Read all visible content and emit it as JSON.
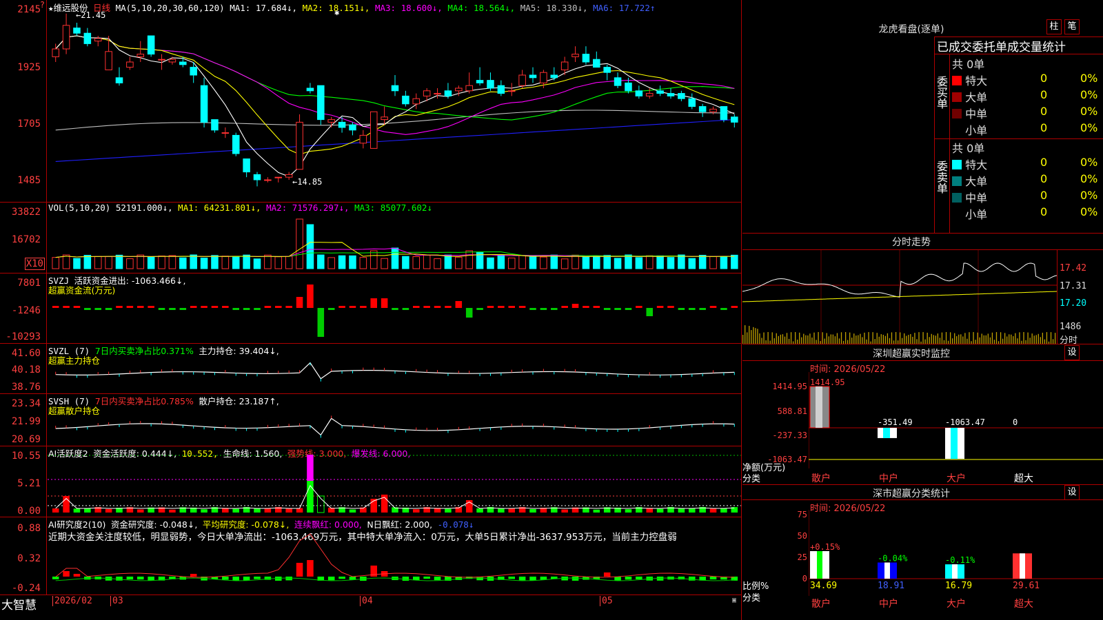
{
  "stock": {
    "name": "维远股份",
    "period": "日线",
    "star": "★"
  },
  "ma_line": {
    "prefix": "MA(5,10,20,30,60,120)",
    "ma1": "MA1: 17.684↓,",
    "ma2": "MA2: 18.151↓,",
    "ma3": "MA3: 18.600↓,",
    "ma4": "MA4: 18.564↓,",
    "ma5": "MA5: 18.330↓,",
    "ma6": "MA6: 17.722↑"
  },
  "price_axis": [
    "2145",
    "1925",
    "1705",
    "1485"
  ],
  "price_axis_top_marker": "?",
  "price_annotations": {
    "high": "←21.45",
    "low": "←14.85"
  },
  "vol_line": {
    "prefix": "VOL(5,10,20)",
    "value": "52191.000↓,",
    "ma1": "MA1: 64231.801↓,",
    "ma2": "MA2: 71576.297↓,",
    "ma3": "MA3: 85077.602↓"
  },
  "vol_axis": [
    "33822",
    "16702"
  ],
  "vol_axis_mult": "X10",
  "svzj": {
    "prefix": "SVZJ",
    "label": "活跃资金进出: -1063.466↓,",
    "sub": "超赢资金流(万元)"
  },
  "svzj_axis": [
    "7801",
    "-1246",
    "-10293"
  ],
  "svzl": {
    "prefix": "SVZL (7)",
    "label1": "7日内买卖净占比0.371%",
    "label2": "主力持仓: 39.404↓,",
    "sub": "超赢主力持仓"
  },
  "svzl_axis": [
    "41.60",
    "40.18",
    "38.76"
  ],
  "svsh": {
    "prefix": "SVSH (7)",
    "label1": "7日内买卖净占比0.785%",
    "label2": "散户持仓: 23.187↑,",
    "sub": "超赢散户持仓"
  },
  "svsh_axis": [
    "23.34",
    "21.99",
    "20.69"
  ],
  "ai1": {
    "prefix": "AI活跃度2",
    "l1": "资金活跃度: 0.444↓,",
    "l2": "10.552,",
    "l3": "生命线: 1.560,",
    "l4": "强势线: 3.000,",
    "l5": "爆发线: 6.000,"
  },
  "ai1_axis": [
    "10.55",
    "5.21",
    "0.00"
  ],
  "ai2": {
    "prefix": "AI研究度2(10)",
    "l1": "资金研究度: -0.048↓,",
    "l2": "平均研究度: -0.078↓,",
    "l3": "连续飘红: 0.000,",
    "l4": "N日飘红: 2.000,",
    "l5": "-0.078↓",
    "note": "近期大资金关注度较低，明显弱势，今日大单净流出：-1063.469万元，其中特大单净流入：0万元，大单5日累计净出-3637.953万元，当前主力控盘弱"
  },
  "ai2_axis": [
    "0.88",
    "0.32",
    "-0.24"
  ],
  "bottom_bar": {
    "logo": "大智慧",
    "months": [
      "2026/02",
      "03",
      "04",
      "05"
    ]
  },
  "right": {
    "longhu_title": "龙虎看盘(逐单)",
    "btn1": "柱",
    "btn2": "笔",
    "stat_title": "已成交委托单成交量统计",
    "buy": {
      "side": "委买单",
      "total": "共 0单",
      "rows": [
        {
          "label": "特大",
          "v": "0",
          "p": "0%",
          "color": "#ff0000"
        },
        {
          "label": "大单",
          "v": "0",
          "p": "0%",
          "color": "#a00000"
        },
        {
          "label": "中单",
          "v": "0",
          "p": "0%",
          "color": "#700000"
        },
        {
          "label": "小单",
          "v": "0",
          "p": "0%",
          "color": ""
        }
      ]
    },
    "sell": {
      "side": "委卖单",
      "total": "共 0单",
      "rows": [
        {
          "label": "特大",
          "v": "0",
          "p": "0%",
          "color": "#00ffff"
        },
        {
          "label": "大单",
          "v": "0",
          "p": "0%",
          "color": "#008080"
        },
        {
          "label": "中单",
          "v": "0",
          "p": "0%",
          "color": "#006060"
        },
        {
          "label": "小单",
          "v": "0",
          "p": "0%",
          "color": ""
        }
      ]
    },
    "intraday": {
      "title": "分时走势",
      "axis": [
        "17.42",
        "17.31",
        "17.20"
      ],
      "vol_axis": "1486",
      "vol_label": "分时"
    },
    "sz_monitor": {
      "title": "深圳超赢实时监控",
      "btn": "设",
      "time": "时间: 2026/05/22",
      "axis": [
        "1414.95",
        "588.81",
        "-237.33",
        "-1063.47"
      ],
      "values": [
        "1414.95",
        "-351.49",
        "-1063.47",
        "0"
      ],
      "unit": "净额(万元)",
      "cat": "分类",
      "cats": [
        "散户",
        "中户",
        "大户",
        "超大"
      ]
    },
    "sz_class": {
      "title": "深市超赢分类统计",
      "btn": "设",
      "time": "时间: 2026/05/22",
      "axis": [
        "75",
        "50",
        "25",
        "0"
      ],
      "pct": [
        "+0.15%",
        "-0.04%",
        "-0.11%"
      ],
      "vals": [
        "34.69",
        "18.91",
        "16.79",
        "29.61"
      ],
      "unit": "比例%",
      "cat": "分类",
      "cats": [
        "散户",
        "中户",
        "大户",
        "超大"
      ]
    }
  },
  "chart_data": {
    "type": "candlestick",
    "title": "维远股份 日线",
    "ohlc": [
      [
        19.8,
        20.3,
        19.6,
        20.1
      ],
      [
        20.1,
        21.45,
        19.9,
        21.0
      ],
      [
        20.9,
        21.1,
        20.6,
        20.7
      ],
      [
        20.7,
        20.9,
        20.2,
        20.3
      ],
      [
        20.4,
        20.6,
        20.2,
        20.5
      ],
      [
        19.3,
        20.6,
        19.3,
        20.0
      ],
      [
        19.0,
        19.4,
        18.7,
        18.8
      ],
      [
        19.4,
        19.8,
        19.3,
        19.6
      ],
      [
        19.8,
        20.4,
        19.6,
        19.9
      ],
      [
        20.6,
        20.6,
        19.8,
        19.9
      ],
      [
        19.7,
        19.9,
        19.3,
        19.7
      ],
      [
        19.6,
        19.8,
        19.5,
        19.7
      ],
      [
        19.6,
        19.8,
        19.4,
        19.5
      ],
      [
        19.4,
        19.6,
        18.8,
        19.1
      ],
      [
        18.7,
        19.0,
        17.1,
        17.3
      ],
      [
        17.4,
        17.4,
        16.9,
        17.0
      ],
      [
        16.9,
        17.1,
        16.7,
        16.9
      ],
      [
        16.8,
        16.9,
        16.0,
        16.1
      ],
      [
        15.9,
        15.9,
        15.2,
        15.4
      ],
      [
        15.3,
        15.4,
        14.85,
        15.1
      ],
      [
        15.1,
        15.2,
        15.0,
        15.1
      ],
      [
        15.2,
        15.2,
        15.0,
        15.2
      ],
      [
        15.2,
        15.4,
        15.1,
        15.3
      ],
      [
        15.5,
        17.6,
        15.5,
        17.3
      ],
      [
        18.6,
        18.8,
        18.4,
        18.5
      ],
      [
        18.7,
        18.7,
        17.2,
        17.4
      ],
      [
        17.3,
        17.5,
        17.1,
        17.4
      ],
      [
        17.3,
        17.5,
        16.9,
        17.1
      ],
      [
        17.2,
        17.3,
        16.8,
        17.0
      ],
      [
        16.5,
        17.0,
        16.3,
        16.8
      ],
      [
        16.3,
        17.5,
        16.3,
        17.7
      ],
      [
        17.4,
        17.9,
        17.2,
        17.5
      ],
      [
        18.7,
        19.1,
        18.3,
        18.5
      ],
      [
        18.3,
        18.5,
        17.9,
        18.0
      ],
      [
        18.0,
        18.4,
        17.8,
        18.2
      ],
      [
        18.3,
        18.6,
        18.1,
        18.5
      ],
      [
        18.4,
        18.6,
        18.2,
        18.4
      ],
      [
        18.5,
        18.8,
        18.2,
        18.3
      ],
      [
        18.5,
        18.7,
        18.3,
        18.6
      ],
      [
        18.5,
        19.2,
        18.4,
        18.7
      ],
      [
        18.9,
        19.4,
        18.7,
        18.8
      ],
      [
        18.9,
        19.2,
        18.5,
        18.6
      ],
      [
        18.7,
        18.9,
        18.3,
        18.4
      ],
      [
        18.5,
        18.8,
        18.3,
        18.5
      ],
      [
        18.7,
        19.3,
        18.6,
        19.1
      ],
      [
        19.1,
        19.4,
        18.8,
        19.0
      ],
      [
        18.8,
        19.3,
        18.6,
        19.2
      ],
      [
        19.1,
        19.4,
        18.9,
        19.0
      ],
      [
        19.3,
        19.8,
        19.1,
        19.6
      ],
      [
        19.8,
        20.2,
        19.6,
        19.9
      ],
      [
        19.9,
        20.2,
        19.5,
        19.6
      ],
      [
        19.7,
        20.0,
        19.4,
        19.4
      ],
      [
        19.4,
        19.5,
        18.9,
        19.2
      ],
      [
        19.0,
        19.2,
        18.6,
        18.7
      ],
      [
        18.8,
        19.0,
        18.4,
        18.5
      ],
      [
        18.5,
        18.7,
        18.2,
        18.3
      ],
      [
        18.3,
        18.6,
        18.2,
        18.4
      ],
      [
        18.5,
        18.7,
        18.3,
        18.4
      ],
      [
        18.4,
        18.6,
        18.2,
        18.3
      ],
      [
        18.4,
        18.5,
        18.1,
        18.2
      ],
      [
        18.2,
        18.4,
        17.8,
        17.9
      ],
      [
        17.9,
        18.0,
        17.5,
        17.7
      ],
      [
        17.7,
        17.9,
        17.6,
        17.8
      ],
      [
        17.9,
        17.9,
        17.3,
        17.4
      ],
      [
        17.5,
        17.6,
        17.1,
        17.3
      ]
    ],
    "ylim": [
      14.6,
      21.6
    ]
  }
}
